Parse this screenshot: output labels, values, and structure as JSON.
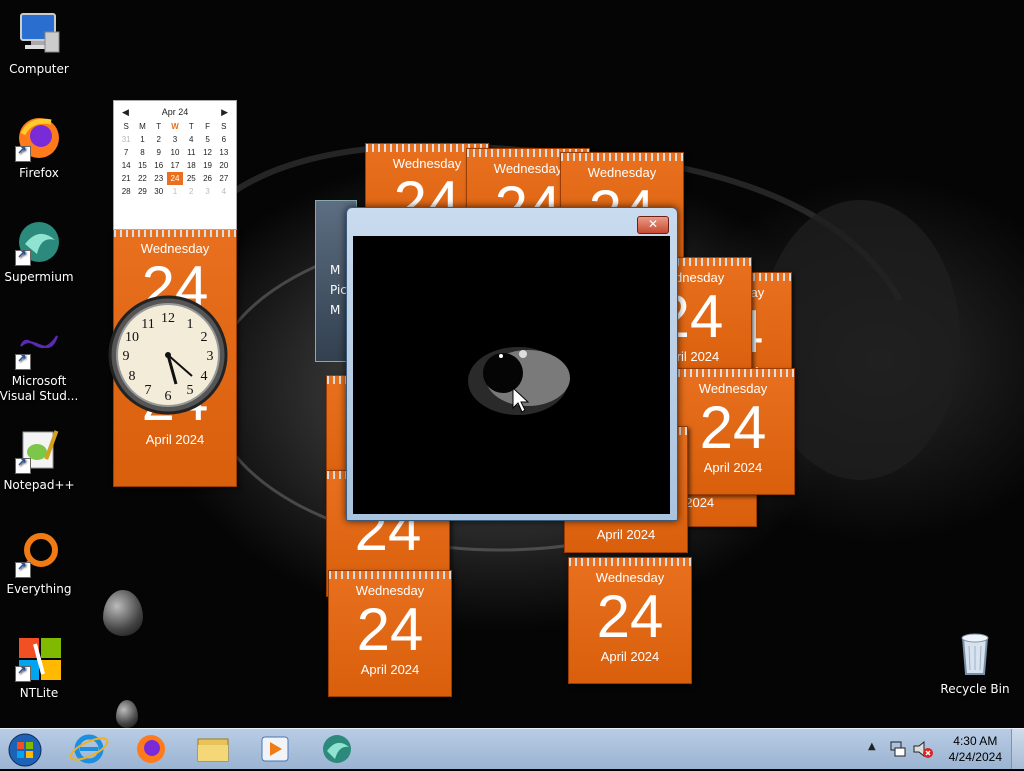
{
  "desktop_icons": [
    {
      "label": "Computer",
      "icon": "computer-icon"
    },
    {
      "label": "Firefox",
      "icon": "firefox-icon"
    },
    {
      "label": "Supermium",
      "icon": "supermium-icon"
    },
    {
      "label": "Microsoft Visual Stud...",
      "icon": "visual-studio-icon"
    },
    {
      "label": "Notepad++",
      "icon": "notepadpp-icon"
    },
    {
      "label": "Everything",
      "icon": "everything-icon"
    },
    {
      "label": "NTLite",
      "icon": "ntlite-icon"
    },
    {
      "label": "Recycle Bin",
      "icon": "recycle-bin-icon"
    }
  ],
  "mini_calendar": {
    "month": "Apr 24",
    "weekdays": [
      "S",
      "M",
      "T",
      "W",
      "T",
      "F",
      "S"
    ],
    "weeks": [
      [
        "31",
        "1",
        "2",
        "3",
        "4",
        "5",
        "6"
      ],
      [
        "7",
        "8",
        "9",
        "10",
        "11",
        "12",
        "13"
      ],
      [
        "14",
        "15",
        "16",
        "17",
        "18",
        "19",
        "20"
      ],
      [
        "21",
        "22",
        "23",
        "24",
        "25",
        "26",
        "27"
      ],
      [
        "28",
        "29",
        "30",
        "1",
        "2",
        "3",
        "4"
      ]
    ],
    "today": "24"
  },
  "calendar_gadget": {
    "weekday": "Wednesday",
    "day": "24",
    "month_year": "April 2024",
    "partial_month_year": "il 2024"
  },
  "hidden_menu_items": [
    "M",
    "Pic",
    "M"
  ],
  "window": {
    "close_label": "✕"
  },
  "taskbar": {
    "start": "start-orb-icon",
    "pinned": [
      "internet-explorer-icon",
      "firefox-icon",
      "file-explorer-icon",
      "media-player-icon",
      "supermium-icon"
    ],
    "time": "4:30 AM",
    "date": "4/24/2024"
  },
  "colors": {
    "gadget_orange": "#e8701e",
    "taskbar": "#a9c0dc"
  }
}
